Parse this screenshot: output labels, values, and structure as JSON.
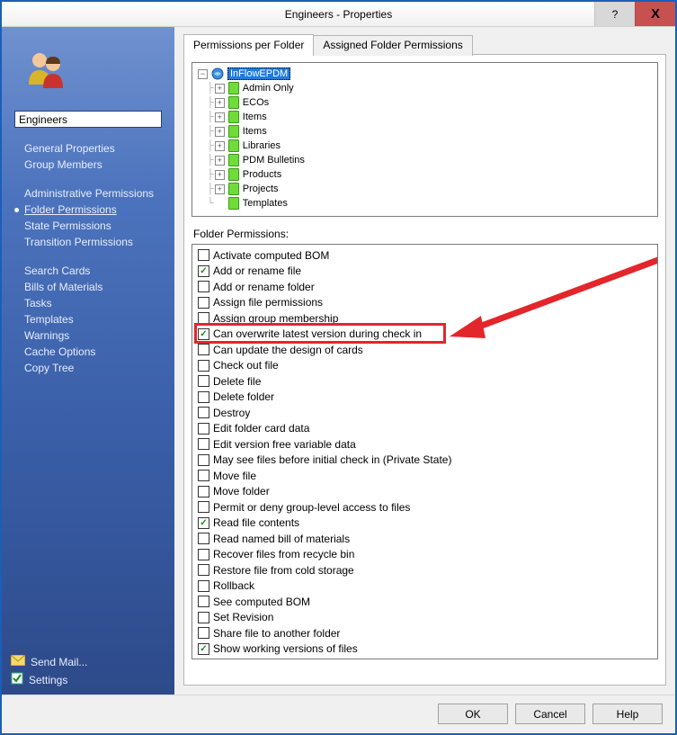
{
  "window": {
    "title": "Engineers - Properties",
    "help_btn": "?",
    "close_btn": "X"
  },
  "sidebar": {
    "name_value": "Engineers",
    "groups": [
      {
        "items": [
          {
            "label": "General Properties",
            "active": false
          },
          {
            "label": "Group Members",
            "active": false
          }
        ]
      },
      {
        "items": [
          {
            "label": "Administrative Permissions",
            "active": false
          },
          {
            "label": "Folder Permissions",
            "active": true
          },
          {
            "label": "State Permissions",
            "active": false
          },
          {
            "label": "Transition Permissions",
            "active": false
          }
        ]
      },
      {
        "items": [
          {
            "label": "Search Cards",
            "active": false
          },
          {
            "label": "Bills of Materials",
            "active": false
          },
          {
            "label": "Tasks",
            "active": false
          },
          {
            "label": "Templates",
            "active": false
          },
          {
            "label": "Warnings",
            "active": false
          },
          {
            "label": "Cache Options",
            "active": false
          },
          {
            "label": "Copy Tree",
            "active": false
          }
        ]
      }
    ],
    "bottom": {
      "send_mail": "Send Mail...",
      "settings": "Settings"
    }
  },
  "tabs": {
    "t0": "Permissions per Folder",
    "t1": "Assigned Folder Permissions"
  },
  "tree": {
    "root": "InFlowEPDM",
    "children": [
      "Admin Only",
      "ECOs",
      "Items",
      "Items",
      "Libraries",
      "PDM Bulletins",
      "Products",
      "Projects",
      "Templates"
    ]
  },
  "section_label": "Folder Permissions:",
  "permissions": [
    {
      "label": "Activate computed BOM",
      "checked": false
    },
    {
      "label": "Add or rename file",
      "checked": true
    },
    {
      "label": "Add or rename folder",
      "checked": false
    },
    {
      "label": "Assign file permissions",
      "checked": false
    },
    {
      "label": "Assign group membership",
      "checked": false
    },
    {
      "label": "Can overwrite latest version during check in",
      "checked": true
    },
    {
      "label": "Can update the design of cards",
      "checked": false
    },
    {
      "label": "Check out file",
      "checked": false
    },
    {
      "label": "Delete file",
      "checked": false
    },
    {
      "label": "Delete folder",
      "checked": false
    },
    {
      "label": "Destroy",
      "checked": false
    },
    {
      "label": "Edit folder card data",
      "checked": false
    },
    {
      "label": "Edit version free variable data",
      "checked": false
    },
    {
      "label": "May see files before initial check in (Private State)",
      "checked": false
    },
    {
      "label": "Move file",
      "checked": false
    },
    {
      "label": "Move folder",
      "checked": false
    },
    {
      "label": "Permit or deny group-level access to files",
      "checked": false
    },
    {
      "label": "Read file contents",
      "checked": true
    },
    {
      "label": "Read named bill of materials",
      "checked": false
    },
    {
      "label": "Recover files from recycle bin",
      "checked": false
    },
    {
      "label": "Restore file from cold storage",
      "checked": false
    },
    {
      "label": "Rollback",
      "checked": false
    },
    {
      "label": "See computed BOM",
      "checked": false
    },
    {
      "label": "Set Revision",
      "checked": false
    },
    {
      "label": "Share file to another folder",
      "checked": false
    },
    {
      "label": "Show working versions of files",
      "checked": true
    }
  ],
  "footer": {
    "ok": "OK",
    "cancel": "Cancel",
    "help": "Help"
  },
  "annotation": {
    "highlight_index": 5,
    "arrow_color": "#e3262b"
  }
}
